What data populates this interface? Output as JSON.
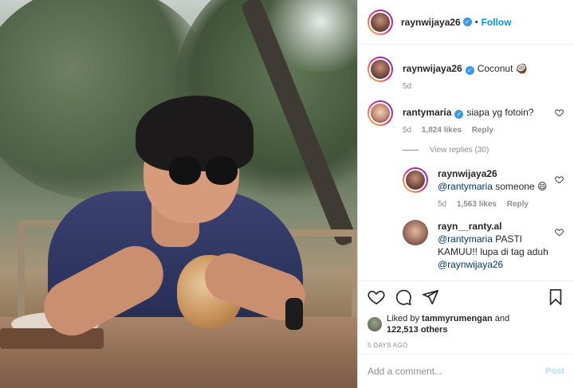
{
  "header": {
    "username": "raynwijaya26",
    "separator": "•",
    "follow_label": "Follow",
    "verified_mark": "✓"
  },
  "caption": {
    "username": "raynwijaya26",
    "text": "Coconut 🥥",
    "age": "5d"
  },
  "comments": [
    {
      "username": "rantymaria",
      "text": "siapa yg fotoin?",
      "age": "5d",
      "likes": "1,824 likes",
      "reply_label": "Reply",
      "view_replies": "View replies (30)"
    }
  ],
  "replies": [
    {
      "username": "raynwijaya26",
      "mention": "@rantymaria",
      "text": "someone 😄",
      "age": "5d",
      "likes": "1,563 likes",
      "reply_label": "Reply"
    },
    {
      "username": "rayn__ranty.al",
      "mention": "@rantymaria",
      "text": "PASTI KAMUU!! lupa di tag aduh",
      "mention2": "@raynwijaya26"
    }
  ],
  "likes": {
    "prefix": "Liked by",
    "liker": "tammyrumengan",
    "and": "and",
    "count": "122,513 others"
  },
  "timestamp": "5 DAYS AGO",
  "comment_box": {
    "placeholder": "Add a comment...",
    "post_label": "Post"
  },
  "colors": {
    "link": "#0095f6",
    "mention": "#00376b",
    "muted": "#8e8e8e"
  },
  "icons": [
    "heart-icon",
    "comment-icon",
    "share-icon",
    "bookmark-icon",
    "verified-badge-icon"
  ]
}
